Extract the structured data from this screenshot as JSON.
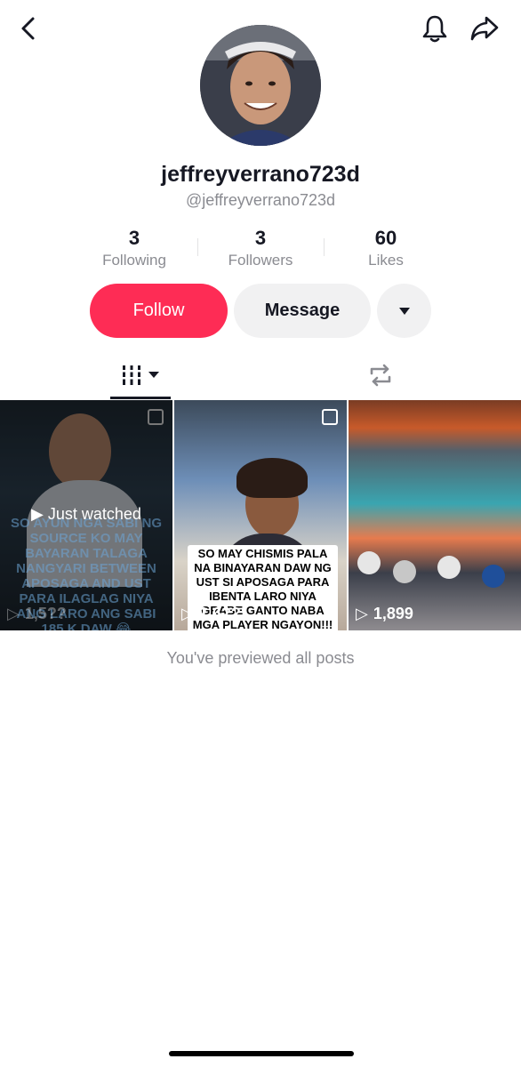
{
  "header": {
    "back_icon": "chevron-left-icon",
    "bell_icon": "bell-icon",
    "share_icon": "share-arrow-icon"
  },
  "profile": {
    "username": "jeffreyverrano723d",
    "handle": "@jeffreyverrano723d",
    "stats": [
      {
        "value": "3",
        "label": "Following"
      },
      {
        "value": "3",
        "label": "Followers"
      },
      {
        "value": "60",
        "label": "Likes"
      }
    ]
  },
  "actions": {
    "follow_label": "Follow",
    "message_label": "Message",
    "more_icon": "caret-down-icon"
  },
  "tabs": {
    "videos_icon": "grid-icon",
    "reposts_icon": "repost-icon"
  },
  "videos": [
    {
      "caption": "SO AYUN NGA SABI NG SOURCE KO MAY BAYARAN TALAGA NANGYARI BETWEEN APOSAGA AND UST PARA ILAGLAG NIYA ANG LARO ANG SABI 185 K DAW 😂",
      "badge": "Just watched",
      "views": "1,5??"
    },
    {
      "caption": "SO MAY CHISMIS PALA NA BINAYARAN DAW NG UST SI APOSAGA PARA IBENTA LARO NIYA GRABE GANTO NABA MGA PLAYER NGAYON!!!",
      "views": "1,6??"
    },
    {
      "views": "1,899"
    }
  ],
  "footer": {
    "end_text": "You've previewed all posts"
  },
  "colors": {
    "accent": "#fe2c55",
    "secondary_text": "#8a8b91"
  }
}
